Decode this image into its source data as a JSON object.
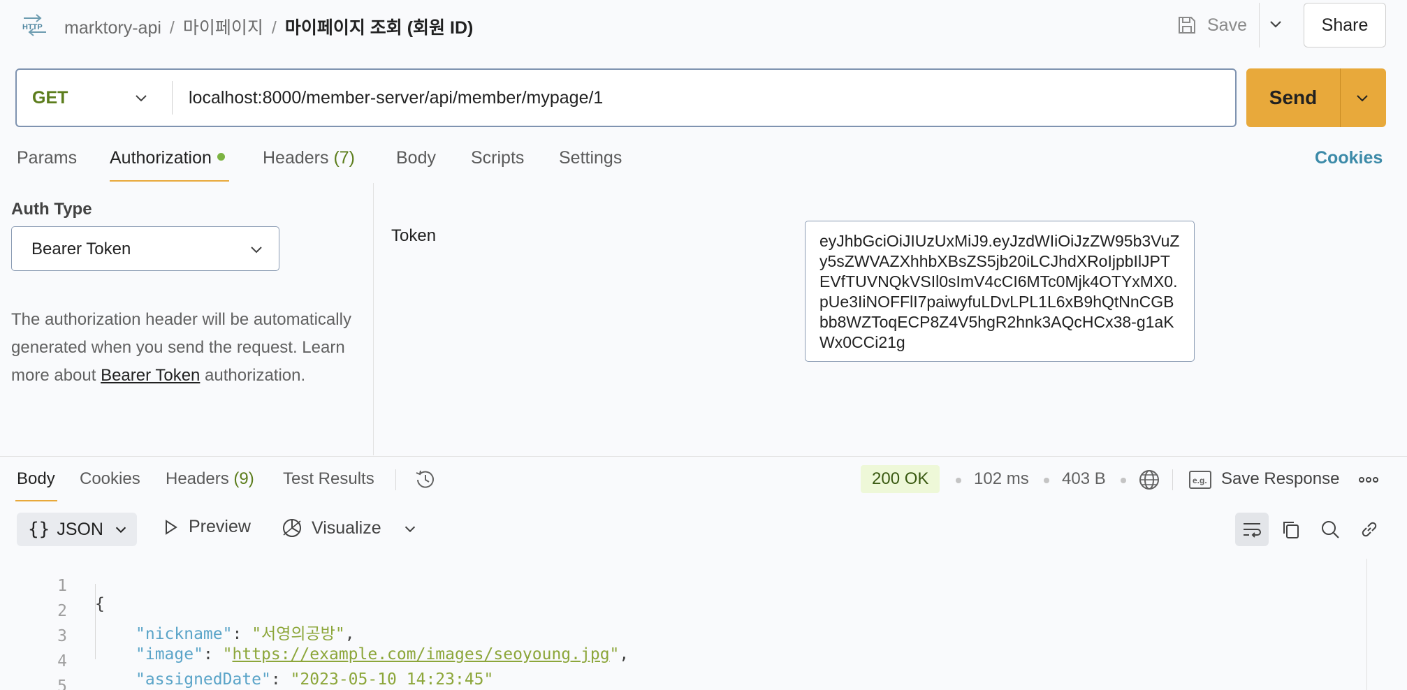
{
  "header": {
    "breadcrumb": [
      "marktory-api",
      "마이페이지",
      "마이페이지 조회 (회원 ID)"
    ],
    "save_label": "Save",
    "share_label": "Share"
  },
  "request": {
    "method": "GET",
    "url": "localhost:8000/member-server/api/member/mypage/1",
    "send_label": "Send"
  },
  "request_tabs": {
    "params": "Params",
    "authorization": "Authorization",
    "headers": "Headers",
    "headers_count": "(7)",
    "body": "Body",
    "scripts": "Scripts",
    "settings": "Settings",
    "cookies": "Cookies"
  },
  "auth": {
    "type_label": "Auth Type",
    "type_value": "Bearer Token",
    "description_before": "The authorization header will be automatically generated when you send the request. Learn more about ",
    "description_link": "Bearer Token",
    "description_after": " authorization.",
    "token_label": "Token",
    "token_value": "eyJhbGciOiJIUzUxMiJ9.eyJzdWIiOiJzZW95b3VuZy5sZWVAZXhhbXBsZS5jb20iLCJhdXRoIjpbIlJPTEVfTUVNQkVSIl0sImV4cCI6MTc0Mjk4OTYxMX0.pUe3IiNOFFlI7paiwyfuLDvLPL1L6xB9hQtNnCGBbb8WZToqECP8Z4V5hgR2hnk3AQcHCx38-g1aKWx0CCi21g"
  },
  "response_tabs": {
    "body": "Body",
    "cookies": "Cookies",
    "headers": "Headers",
    "headers_count": "(9)",
    "test_results": "Test Results"
  },
  "response_meta": {
    "status": "200 OK",
    "time": "102 ms",
    "size": "403 B",
    "save_response": "Save Response"
  },
  "body_toolbar": {
    "format": "JSON",
    "preview": "Preview",
    "visualize": "Visualize"
  },
  "code": {
    "line_numbers": [
      "1",
      "2",
      "3",
      "4",
      "5"
    ],
    "open_brace": "{",
    "close_brace": "}",
    "fields": [
      {
        "key": "\"nickname\"",
        "value": "\"서영의공방\"",
        "trail": ","
      },
      {
        "key": "\"image\"",
        "value": "https://example.com/images/seoyoung.jpg",
        "trail": ","
      },
      {
        "key": "\"assignedDate\"",
        "value": "\"2023-05-10 14:23:45\"",
        "trail": ""
      }
    ]
  },
  "colors": {
    "accent": "#e8a93b",
    "method_get": "#5c7d1c",
    "status_ok_bg": "#eef8d8",
    "json_key": "#5aa4c8",
    "json_string": "#8ca63a",
    "link": "#3c8aa8"
  },
  "icons": [
    "http-icon",
    "save-icon",
    "chevron-down-icon",
    "history-icon",
    "globe-icon",
    "example-icon",
    "more-icon",
    "play-icon",
    "visualize-icon",
    "wrap-icon",
    "copy-icon",
    "search-icon",
    "link-icon"
  ]
}
